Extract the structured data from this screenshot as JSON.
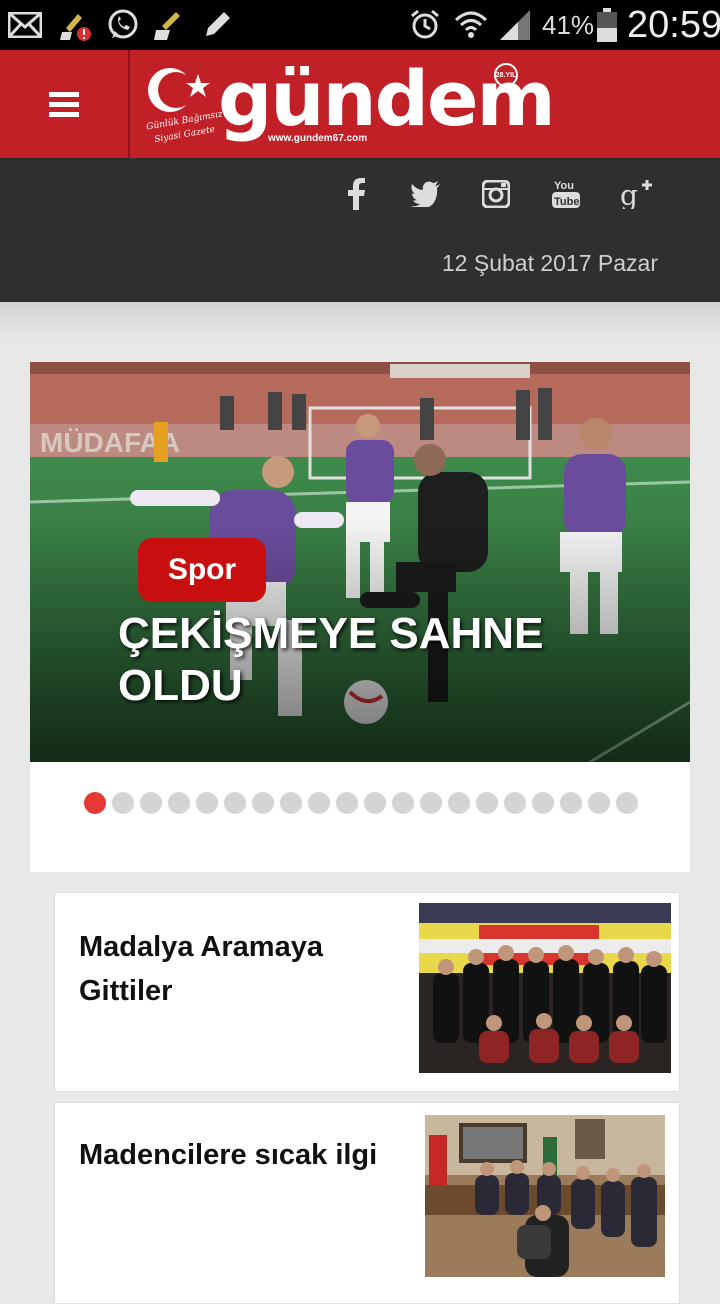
{
  "status_bar": {
    "battery": "41%",
    "time": "20:59",
    "icons": [
      "mail-icon",
      "cleaner-alert-icon",
      "whatsapp-icon",
      "cleaner-icon",
      "pencil-icon",
      "alarm-icon",
      "wifi-icon",
      "signal-icon",
      "battery-icon"
    ]
  },
  "header": {
    "logo_text": "gündem",
    "logo_url": "www.gundem67.com",
    "logo_tagline_1": "Günlük Bağımsız",
    "logo_tagline_2": "Siyasi Gazete",
    "logo_badge": "28.YIL"
  },
  "social": {
    "icons": [
      "facebook-icon",
      "twitter-icon",
      "instagram-icon",
      "youtube-icon",
      "google-plus-icon"
    ],
    "date": "12 Şubat 2017 Pazar"
  },
  "slider": {
    "category": "Spor",
    "headline": "ÇEKİŞMEYE SAHNE OLDU",
    "total_slides": 20,
    "active_slide": 1
  },
  "news": [
    {
      "title": "Madalya Aramaya Gittiler"
    },
    {
      "title": "Madencilere sıcak ilgi"
    }
  ],
  "colors": {
    "brand_red": "#c22027",
    "category_red": "#c70f0f",
    "dark_bar": "#2f2f2f",
    "active_dot": "#e53935"
  }
}
